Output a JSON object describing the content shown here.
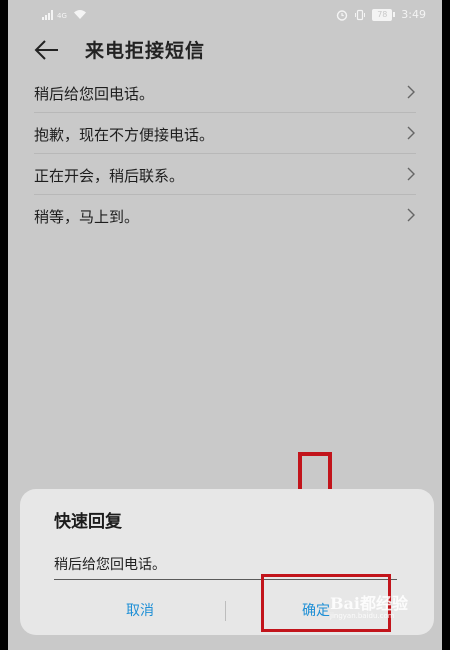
{
  "status_bar": {
    "network_type": "4G",
    "battery_level": "78",
    "time": "3:49"
  },
  "header": {
    "title": "来电拒接短信"
  },
  "messages": [
    {
      "label": "稍后给您回电话。"
    },
    {
      "label": "抱歉，现在不方便接电话。"
    },
    {
      "label": "正在开会，稍后联系。"
    },
    {
      "label": "稍等，马上到。"
    }
  ],
  "dialog": {
    "title": "快速回复",
    "input_value": "稍后给您回电话。",
    "cancel_label": "取消",
    "confirm_label": "确定"
  },
  "watermark": {
    "text": "Bai都经验",
    "sub": "jingyan.baidu.com"
  },
  "colors": {
    "accent": "#1e8fd6",
    "annotation": "#c2141b",
    "background": "#c9c9c9",
    "dialog_bg": "#e7e7e7"
  },
  "icons": {
    "back": "arrow-left-icon",
    "row_chevron": "chevron-right-icon",
    "annotation_arrow": "down-arrow-annotation"
  }
}
